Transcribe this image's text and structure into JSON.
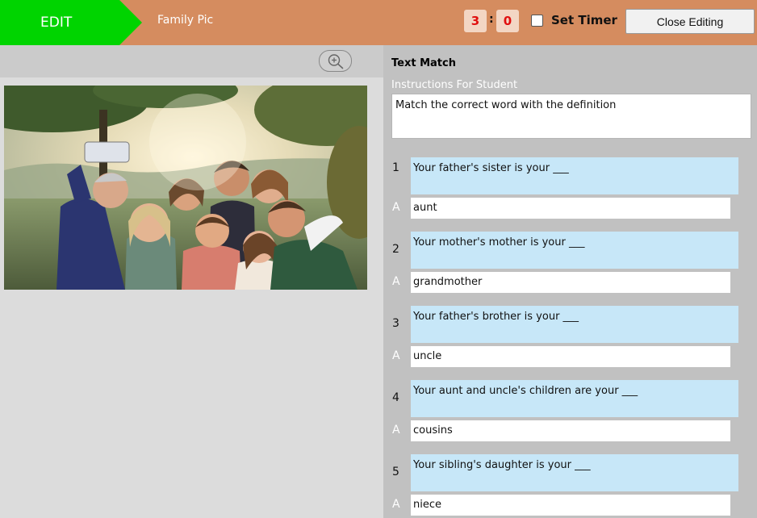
{
  "header": {
    "mode_label": "EDIT",
    "title": "Family Pic",
    "timer": {
      "minutes": "3",
      "separator": ":",
      "seconds": "0",
      "label": "Set Timer",
      "checked": false
    },
    "close_label": "Close Editing"
  },
  "toolbar": {
    "zoom_icon": "zoom-in-icon"
  },
  "image": {
    "description_icon": "family-selfie-photo"
  },
  "activity": {
    "type": "Text Match",
    "instructions_label": "Instructions For Student",
    "instructions": "Match the correct word with the definition",
    "answer_marker": "A",
    "items": [
      {
        "number": "1",
        "question": "Your father's sister is your ___",
        "answer": "aunt"
      },
      {
        "number": "2",
        "question": "Your mother's mother is your ___",
        "answer": "grandmother"
      },
      {
        "number": "3",
        "question": "Your father's brother is your ___",
        "answer": "uncle"
      },
      {
        "number": "4",
        "question": "Your aunt and uncle's children are your ___",
        "answer": "cousins"
      },
      {
        "number": "5",
        "question": "Your sibling's daughter is your ___",
        "answer": "niece"
      }
    ]
  },
  "colors": {
    "header_bg": "#d58c5f",
    "edit_tab": "#00d400",
    "timer_text": "#e01010",
    "question_bg": "#c7e7f8",
    "right_pane_bg": "#c1c1c1"
  }
}
